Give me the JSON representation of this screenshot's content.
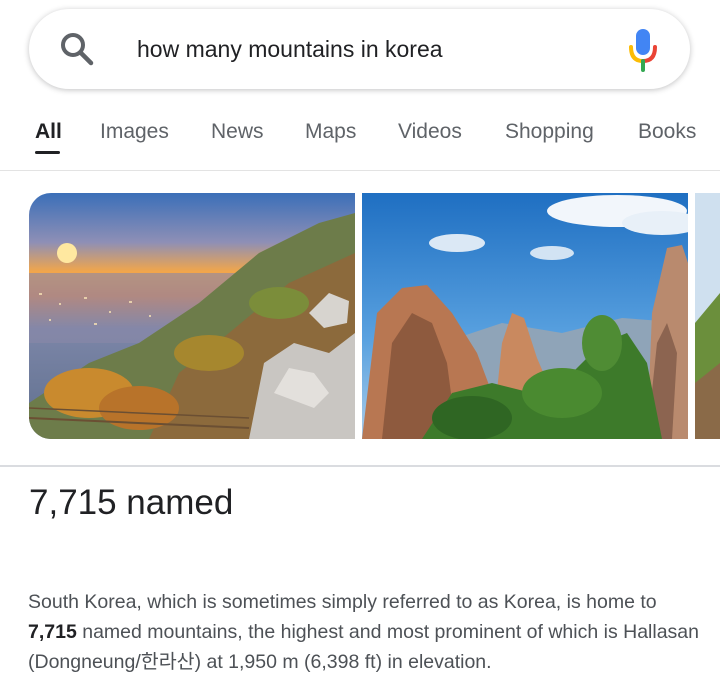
{
  "search": {
    "query": "how many mountains in korea"
  },
  "icons": {
    "search": "search-icon",
    "mic": "microphone-icon"
  },
  "tabs": [
    {
      "label": "All",
      "active": true
    },
    {
      "label": "Images",
      "active": false
    },
    {
      "label": "News",
      "active": false
    },
    {
      "label": "Maps",
      "active": false
    },
    {
      "label": "Videos",
      "active": false
    },
    {
      "label": "Shopping",
      "active": false
    },
    {
      "label": "Books",
      "active": false
    }
  ],
  "answer": {
    "headline": "7,715 named",
    "description_before": "South Korea, which is sometimes simply referred to as Korea, is home to ",
    "description_bold": "7,715",
    "description_after": " named mountains, the highest and most prominent of which is Hallasan (Dongneung/한라산) at 1,950 m (6,398 ft) in elevation."
  },
  "colors": {
    "google_blue": "#4285f4",
    "google_red": "#ea4335",
    "google_yellow": "#fbbc05",
    "google_green": "#34a853",
    "text_primary": "#202124",
    "text_secondary": "#5f6368"
  }
}
